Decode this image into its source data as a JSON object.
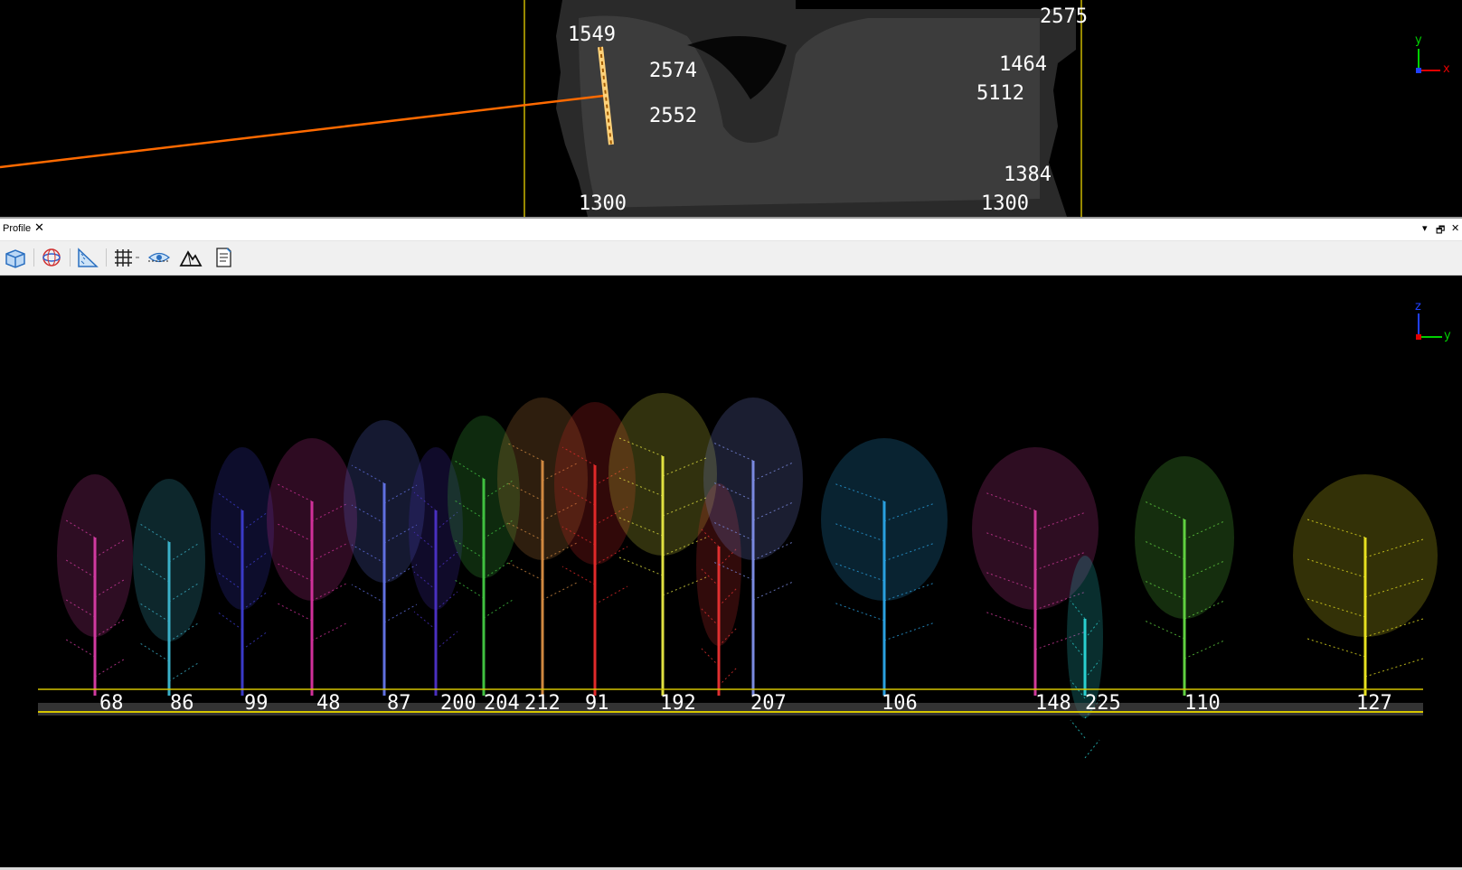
{
  "map_view": {
    "labels": [
      "1549",
      "2574",
      "2552",
      "1384",
      "1300",
      "1464",
      "2575",
      "5112",
      "1300"
    ],
    "axis": {
      "y_label": "y",
      "x_label": "x"
    }
  },
  "profile_panel": {
    "title": "Profile",
    "close_glyph": "✕",
    "controls": {
      "menu_glyph": "▾",
      "float_glyph": "🗗",
      "close_glyph": "✕"
    }
  },
  "toolbar": {
    "buttons": [
      {
        "icon": "cube-icon"
      },
      {
        "icon": "rotate-icon"
      },
      {
        "icon": "measure-triangle-icon"
      },
      {
        "icon": "grid-icon"
      },
      {
        "icon": "hide-eye-icon"
      },
      {
        "icon": "terrain-icon"
      },
      {
        "icon": "report-icon"
      }
    ]
  },
  "profile_view": {
    "axis": {
      "z_label": "z",
      "y_label": "y"
    },
    "tree_ids": [
      "68",
      "86",
      "99",
      "48",
      "87",
      "200",
      "204",
      "212",
      "91",
      "192",
      "207",
      "106",
      "148",
      "225",
      "110",
      "127"
    ],
    "colors": {
      "ground_line": "#d4c400",
      "ground_points": "#8a8a8a",
      "profile_line": "#ff6a00",
      "frame": "#c9b600"
    }
  }
}
